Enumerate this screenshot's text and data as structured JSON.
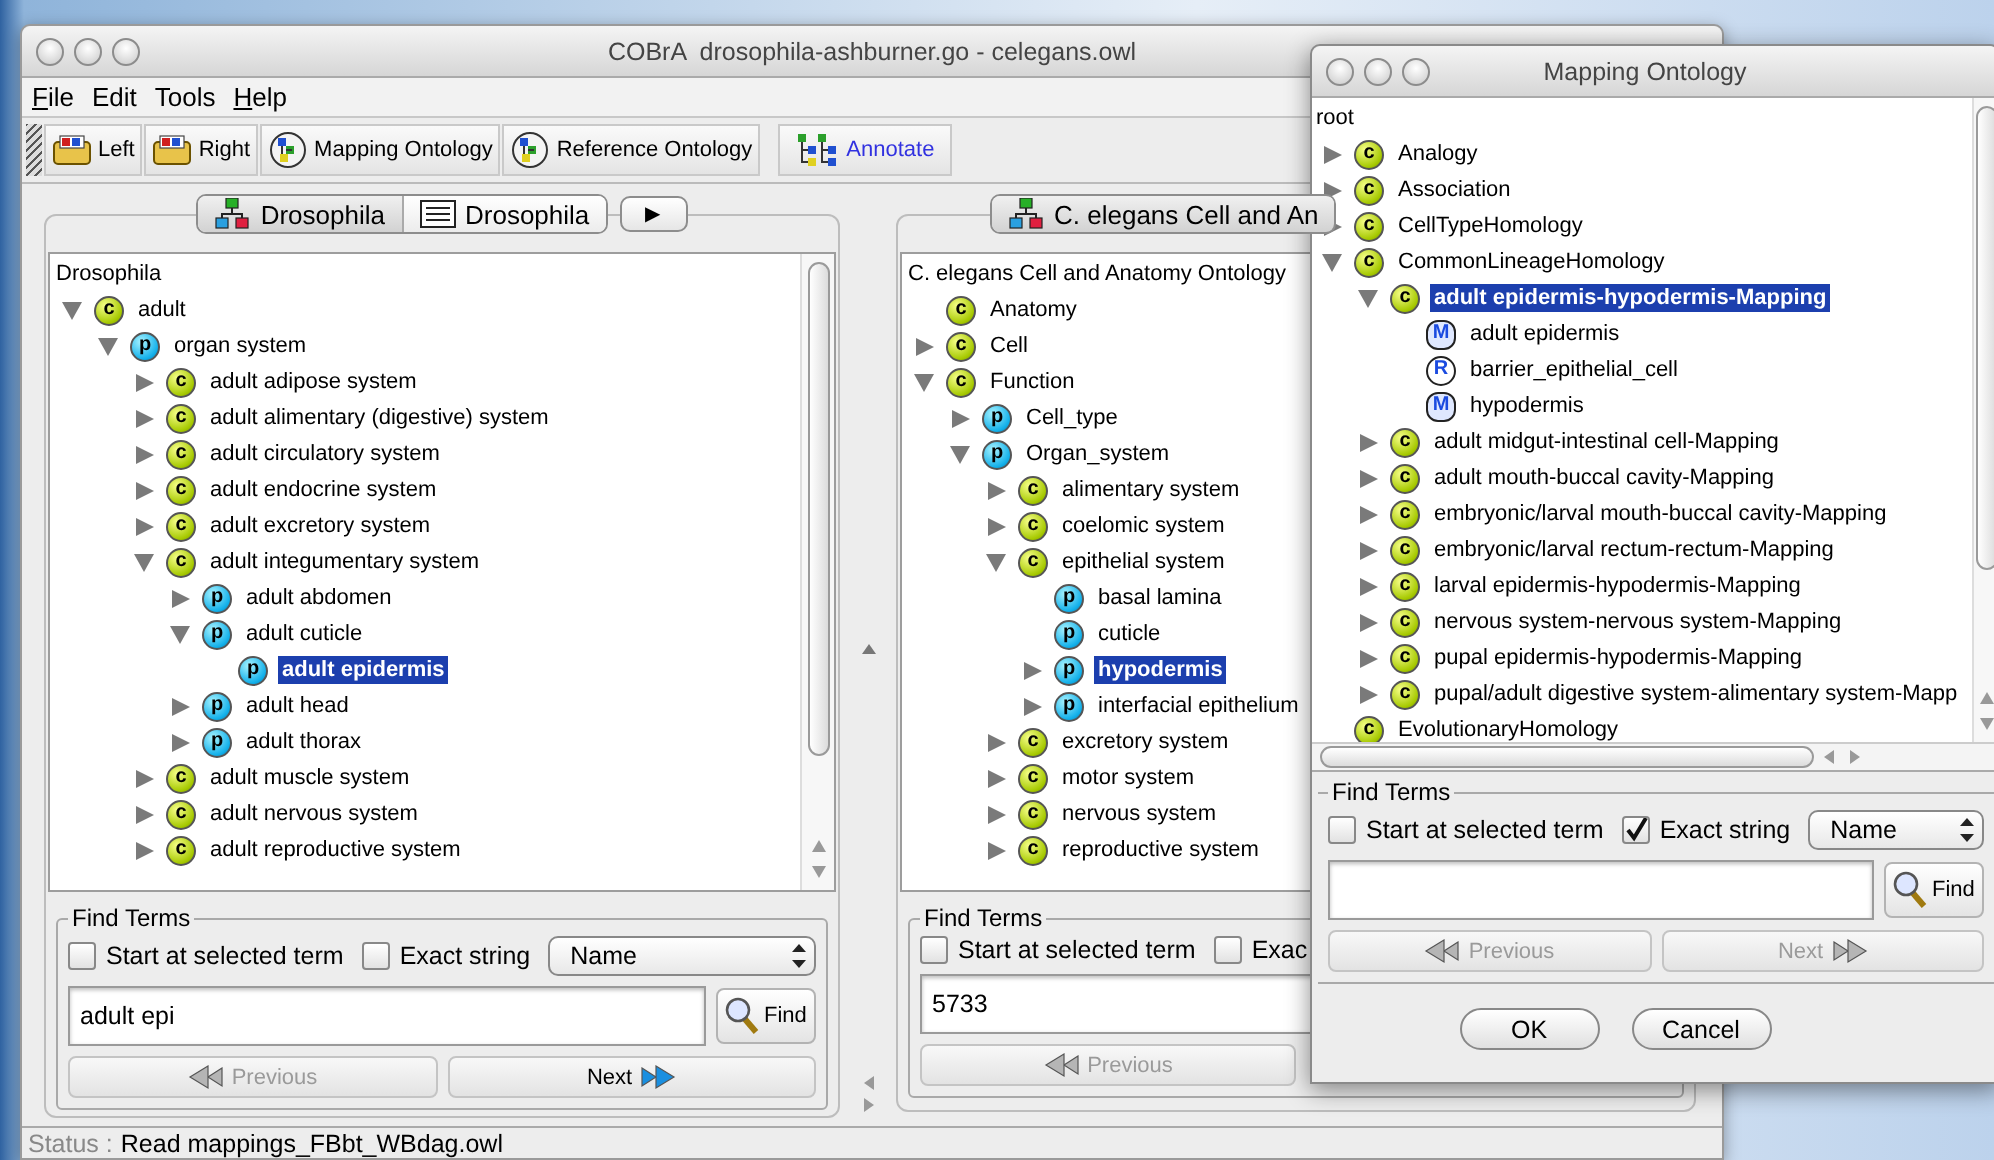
{
  "main_window": {
    "title": "COBrA  drosophila-ashburner.go - celegans.owl",
    "menu": [
      {
        "label": "File",
        "mnemonic": true
      },
      {
        "label": "Edit",
        "mnemonic": false
      },
      {
        "label": "Tools",
        "mnemonic": false
      },
      {
        "label": "Help",
        "mnemonic": true
      }
    ],
    "toolbar": [
      {
        "label": "Left",
        "kind": "folder"
      },
      {
        "label": "Right",
        "kind": "folder"
      },
      {
        "label": "Mapping Ontology",
        "kind": "ontology"
      },
      {
        "label": "Reference Ontology",
        "kind": "ontology"
      },
      {
        "label": "Annotate",
        "kind": "annotate"
      }
    ],
    "panels": [
      {
        "tabs": [
          {
            "label": "Drosophila",
            "kind": "tree",
            "selected": true
          },
          {
            "label": "Drosophila",
            "kind": "list",
            "selected": false
          }
        ],
        "more_button": "▶",
        "tree": {
          "root": "Drosophila",
          "nodes": [
            {
              "label": "adult",
              "kind": "class",
              "badge": "c",
              "expanded": true,
              "selected": false,
              "children": [
                {
                  "label": "organ system",
                  "kind": "property",
                  "badge": "p",
                  "expanded": true,
                  "selected": false,
                  "children": [
                    {
                      "label": "adult adipose system",
                      "kind": "class",
                      "badge": "c",
                      "expanded": false,
                      "selected": false
                    },
                    {
                      "label": "adult alimentary (digestive) system",
                      "kind": "class",
                      "badge": "c",
                      "expanded": false,
                      "selected": false
                    },
                    {
                      "label": "adult circulatory system",
                      "kind": "class",
                      "badge": "c",
                      "expanded": false,
                      "selected": false
                    },
                    {
                      "label": "adult endocrine system",
                      "kind": "class",
                      "badge": "c",
                      "expanded": false,
                      "selected": false
                    },
                    {
                      "label": "adult excretory system",
                      "kind": "class",
                      "badge": "c",
                      "expanded": false,
                      "selected": false
                    },
                    {
                      "label": "adult integumentary system",
                      "kind": "class",
                      "badge": "c",
                      "expanded": true,
                      "selected": false,
                      "children": [
                        {
                          "label": "adult abdomen",
                          "kind": "property",
                          "badge": "p",
                          "expanded": false,
                          "selected": false
                        },
                        {
                          "label": "adult cuticle",
                          "kind": "property",
                          "badge": "p",
                          "expanded": true,
                          "selected": false,
                          "children": [
                            {
                              "label": "adult epidermis",
                              "kind": "property",
                              "badge": "p",
                              "selected": true
                            }
                          ]
                        },
                        {
                          "label": "adult head",
                          "kind": "property",
                          "badge": "p",
                          "expanded": false,
                          "selected": false
                        },
                        {
                          "label": "adult thorax",
                          "kind": "property",
                          "badge": "p",
                          "expanded": false,
                          "selected": false
                        }
                      ]
                    },
                    {
                      "label": "adult muscle system",
                      "kind": "class",
                      "badge": "c",
                      "expanded": false,
                      "selected": false
                    },
                    {
                      "label": "adult nervous system",
                      "kind": "class",
                      "badge": "c",
                      "expanded": false,
                      "selected": false
                    },
                    {
                      "label": "adult reproductive system",
                      "kind": "class",
                      "badge": "c",
                      "expanded": false,
                      "selected": false
                    }
                  ]
                }
              ]
            }
          ]
        },
        "find": {
          "title": "Find Terms",
          "start_at_selected": {
            "label": "Start at selected term",
            "checked": false
          },
          "exact_string": {
            "label": "Exact string",
            "checked": false
          },
          "search_by": "Name",
          "query": "adult epi",
          "find_button": "Find",
          "previous": {
            "label": "Previous",
            "disabled": true
          },
          "next": {
            "label": "Next",
            "disabled": false
          }
        }
      },
      {
        "tabs": [
          {
            "label": "C. elegans Cell and An",
            "kind": "tree",
            "selected": true
          }
        ],
        "tree": {
          "root": "C. elegans Cell and Anatomy Ontology",
          "nodes": [
            {
              "label": "Anatomy",
              "kind": "class",
              "badge": "c",
              "selected": false
            },
            {
              "label": "Cell",
              "kind": "class",
              "badge": "c",
              "expanded": false,
              "selected": false
            },
            {
              "label": "Function",
              "kind": "class",
              "badge": "c",
              "expanded": true,
              "selected": false,
              "children": [
                {
                  "label": "Cell_type",
                  "kind": "property",
                  "badge": "p",
                  "expanded": false,
                  "selected": false
                },
                {
                  "label": "Organ_system",
                  "kind": "property",
                  "badge": "p",
                  "expanded": true,
                  "selected": false,
                  "children": [
                    {
                      "label": "alimentary system",
                      "kind": "class",
                      "badge": "c",
                      "expanded": false,
                      "selected": false
                    },
                    {
                      "label": "coelomic system",
                      "kind": "class",
                      "badge": "c",
                      "expanded": false,
                      "selected": false
                    },
                    {
                      "label": "epithelial system",
                      "kind": "class",
                      "badge": "c",
                      "expanded": true,
                      "selected": false,
                      "children": [
                        {
                          "label": "basal lamina",
                          "kind": "property",
                          "badge": "p",
                          "selected": false
                        },
                        {
                          "label": "cuticle",
                          "kind": "property",
                          "badge": "p",
                          "selected": false
                        },
                        {
                          "label": "hypodermis",
                          "kind": "property",
                          "badge": "p",
                          "expanded": false,
                          "selected": true
                        },
                        {
                          "label": "interfacial epithelium",
                          "kind": "property",
                          "badge": "p",
                          "expanded": false,
                          "selected": false
                        }
                      ]
                    },
                    {
                      "label": "excretory system",
                      "kind": "class",
                      "badge": "c",
                      "expanded": false,
                      "selected": false
                    },
                    {
                      "label": "motor system",
                      "kind": "class",
                      "badge": "c",
                      "expanded": false,
                      "selected": false
                    },
                    {
                      "label": "nervous system",
                      "kind": "class",
                      "badge": "c",
                      "expanded": false,
                      "selected": false
                    },
                    {
                      "label": "reproductive system",
                      "kind": "class",
                      "badge": "c",
                      "expanded": false,
                      "selected": false
                    }
                  ]
                }
              ]
            }
          ]
        },
        "find": {
          "title": "Find Terms",
          "start_at_selected": {
            "label": "Start at selected term",
            "checked": false
          },
          "exact_string": {
            "label": "Exac",
            "checked": false
          },
          "query": "5733",
          "previous": {
            "label": "Previous",
            "disabled": true
          }
        }
      }
    ],
    "status": {
      "label": "Status :",
      "message": "Read mappings_FBbt_WBdag.owl"
    }
  },
  "mapping_dialog": {
    "title": "Mapping Ontology",
    "tree": {
      "root": "root",
      "nodes": [
        {
          "label": "Analogy",
          "kind": "class",
          "badge": "c",
          "expanded": false,
          "selected": false
        },
        {
          "label": "Association",
          "kind": "class",
          "badge": "c",
          "expanded": false,
          "selected": false
        },
        {
          "label": "CellTypeHomology",
          "kind": "class",
          "badge": "c",
          "expanded": false,
          "selected": false
        },
        {
          "label": "CommonLineageHomology",
          "kind": "class",
          "badge": "c",
          "expanded": true,
          "selected": false,
          "children": [
            {
              "label": "adult epidermis-hypodermis-Mapping",
              "kind": "class",
              "badge": "c",
              "expanded": true,
              "selected": true,
              "children": [
                {
                  "label": "adult epidermis",
                  "kind": "mapped",
                  "badge": "M",
                  "selected": false
                },
                {
                  "label": "barrier_epithelial_cell",
                  "kind": "reference",
                  "badge": "R",
                  "selected": false
                },
                {
                  "label": "hypodermis",
                  "kind": "mapped",
                  "badge": "M",
                  "selected": false
                }
              ]
            },
            {
              "label": "adult midgut-intestinal cell-Mapping",
              "kind": "class",
              "badge": "c",
              "expanded": false,
              "selected": false
            },
            {
              "label": "adult mouth-buccal cavity-Mapping",
              "kind": "class",
              "badge": "c",
              "expanded": false,
              "selected": false
            },
            {
              "label": "embryonic/larval mouth-buccal cavity-Mapping",
              "kind": "class",
              "badge": "c",
              "expanded": false,
              "selected": false
            },
            {
              "label": "embryonic/larval rectum-rectum-Mapping",
              "kind": "class",
              "badge": "c",
              "expanded": false,
              "selected": false
            },
            {
              "label": "larval epidermis-hypodermis-Mapping",
              "kind": "class",
              "badge": "c",
              "expanded": false,
              "selected": false
            },
            {
              "label": "nervous system-nervous system-Mapping",
              "kind": "class",
              "badge": "c",
              "expanded": false,
              "selected": false
            },
            {
              "label": "pupal epidermis-hypodermis-Mapping",
              "kind": "class",
              "badge": "c",
              "expanded": false,
              "selected": false
            },
            {
              "label": "pupal/adult digestive system-alimentary system-Mapp",
              "kind": "class",
              "badge": "c",
              "expanded": false,
              "selected": false
            }
          ]
        },
        {
          "label": "EvolutionaryHomology",
          "kind": "class",
          "badge": "c",
          "selected": false
        }
      ]
    },
    "find": {
      "title": "Find Terms",
      "start_at_selected": {
        "label": "Start at selected term",
        "checked": false
      },
      "exact_string": {
        "label": "Exact string",
        "checked": true
      },
      "search_by": "Name",
      "find_button": "Find",
      "previous": {
        "label": "Previous",
        "disabled": true
      },
      "next": {
        "label": "Next",
        "disabled": true
      }
    },
    "buttons": [
      "OK",
      "Cancel"
    ]
  }
}
